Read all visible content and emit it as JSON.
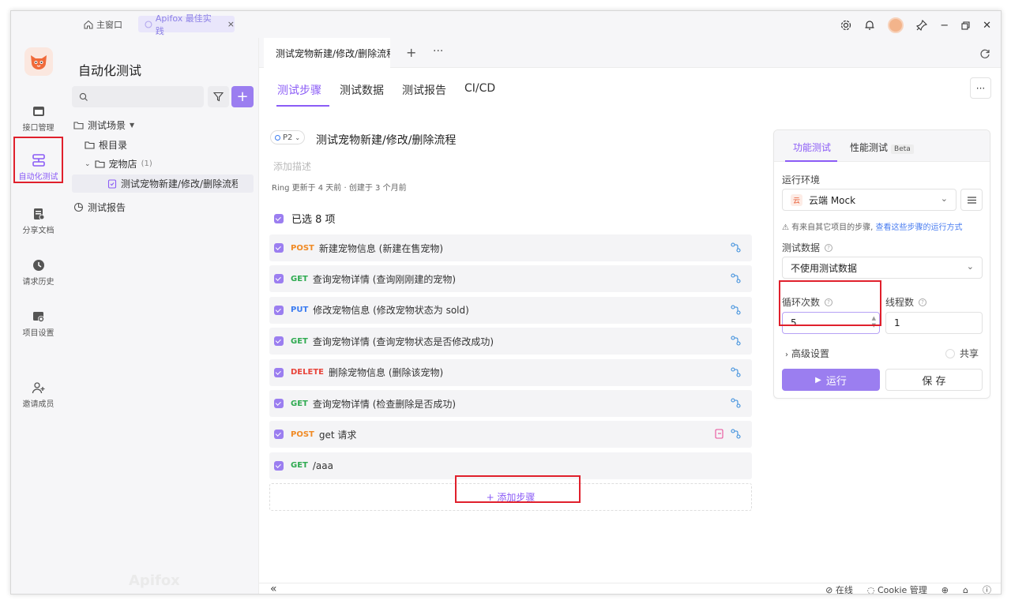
{
  "topbar": {
    "home_label": "主窗口",
    "tab_label": "Apifox 最佳实践",
    "tab_close": "×"
  },
  "rail": {
    "items": [
      {
        "label": "接口管理",
        "icon": "api-icon"
      },
      {
        "label": "自动化测试",
        "icon": "automation-icon",
        "active": true
      },
      {
        "label": "分享文档",
        "icon": "share-doc-icon"
      },
      {
        "label": "请求历史",
        "icon": "history-icon"
      },
      {
        "label": "项目设置",
        "icon": "project-settings-icon"
      },
      {
        "label": "邀请成员",
        "icon": "invite-icon"
      }
    ]
  },
  "tree": {
    "title": "自动化测试",
    "scenarios_label": "测试场景",
    "root_label": "根目录",
    "folder_label": "宠物店",
    "folder_count": "(1)",
    "case_label": "测试宠物新建/修改/删除流程",
    "reports_label": "测试报告",
    "watermark": "Apifox"
  },
  "doc_tabs": {
    "active_tab": "测试宠物新建/修改/删除流程",
    "add": "+",
    "more": "···"
  },
  "sub_tabs": [
    "测试步骤",
    "测试数据",
    "测试报告",
    "CI/CD"
  ],
  "case": {
    "priority": "P2",
    "title": "测试宠物新建/修改/删除流程",
    "desc_placeholder": "添加描述",
    "meta": "Ring 更新于 4 天前 · 创建于 3 个月前",
    "selected": "已选 8 项"
  },
  "steps": [
    {
      "method": "POST",
      "text": "新建宠物信息 (新建在售宠物)"
    },
    {
      "method": "GET",
      "text": "查询宠物详情 (查询刚刚建的宠物)"
    },
    {
      "method": "PUT",
      "text": "修改宠物信息 (修改宠物状态为 sold)"
    },
    {
      "method": "GET",
      "text": "查询宠物详情 (查询宠物状态是否修改成功)"
    },
    {
      "method": "DELETE",
      "text": "删除宠物信息 (删除该宠物)"
    },
    {
      "method": "GET",
      "text": "查询宠物详情 (检查删除是否成功)"
    },
    {
      "method": "POST",
      "text": "get 请求"
    },
    {
      "method": "GET",
      "text": "/aaa"
    }
  ],
  "add_step": "+ 添加步骤",
  "run_panel": {
    "tab_functional": "功能测试",
    "tab_performance": "性能测试",
    "beta": "Beta",
    "env_label": "运行环境",
    "env_value": "云端 Mock",
    "env_badge": "云",
    "tip_text": "有来自其它项目的步骤,",
    "tip_link": "查看这些步骤的运行方式",
    "data_label": "测试数据",
    "data_value": "不使用测试数据",
    "loop_label": "循环次数",
    "loop_value": "5",
    "thread_label": "线程数",
    "thread_value": "1",
    "advanced": "高级设置",
    "share": "共享",
    "run_button": "运行",
    "save_button": "保 存"
  },
  "statusbar": {
    "online": "在线",
    "cookie": "Cookie 管理"
  },
  "colors": {
    "accent": "#8b5cf6",
    "post": "#f08a24",
    "get": "#2eaa50",
    "put": "#3a7bf0",
    "delete": "#e8443a",
    "highlight": "#e0202c"
  }
}
